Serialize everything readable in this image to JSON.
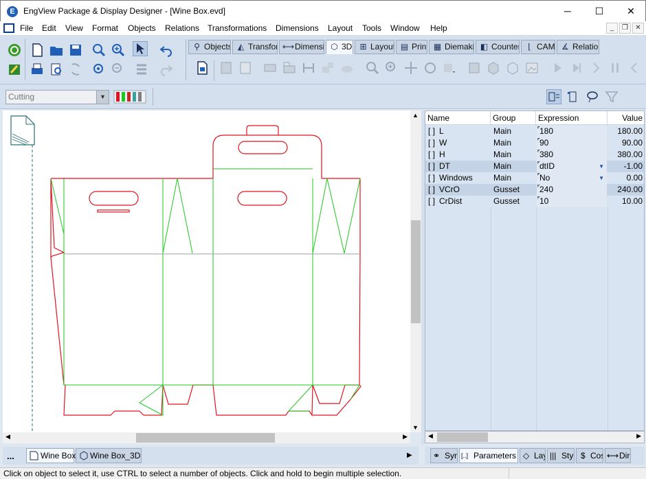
{
  "window": {
    "title": "EngView Package & Display Designer - [Wine Box.evd]",
    "controls": {
      "minimize": "─",
      "maximize": "☐",
      "close": "✕"
    }
  },
  "menu": {
    "items": [
      "File",
      "Edit",
      "View",
      "Format",
      "Objects",
      "Relations",
      "Transformations",
      "Dimensions",
      "Layout",
      "Tools",
      "Window",
      "Help"
    ],
    "mdi": {
      "minimize": "_",
      "restore": "❐",
      "close": "✕"
    }
  },
  "toolbar_tabs": [
    {
      "label": "Objects",
      "glyph": "⚲"
    },
    {
      "label": "Transfor",
      "glyph": "◭"
    },
    {
      "label": "Dimensic",
      "glyph": "⟷"
    },
    {
      "label": "3D",
      "glyph": "⬡"
    },
    {
      "label": "Layout",
      "glyph": "⊞"
    },
    {
      "label": "Print",
      "glyph": "▤"
    },
    {
      "label": "Diemakir",
      "glyph": "▦"
    },
    {
      "label": "Counterp",
      "glyph": "◧"
    },
    {
      "label": "CAM",
      "glyph": "⌊"
    },
    {
      "label": "Relations",
      "glyph": "∡"
    }
  ],
  "active_tab": "3D",
  "mode_combo": {
    "value": "Cutting"
  },
  "parameters": {
    "headers": [
      "Name",
      "Group",
      "Expression",
      "Value"
    ],
    "rows": [
      {
        "name": "L",
        "group": "Main",
        "expression": "180",
        "value": "180.00",
        "dropdown": false
      },
      {
        "name": "W",
        "group": "Main",
        "expression": "90",
        "value": "90.00",
        "dropdown": false
      },
      {
        "name": "H",
        "group": "Main",
        "expression": "380",
        "value": "380.00",
        "dropdown": false
      },
      {
        "name": "DT",
        "group": "Main",
        "expression": "dtID",
        "value": "-1.00",
        "dropdown": true
      },
      {
        "name": "Windows",
        "group": "Main",
        "expression": "No",
        "value": "0.00",
        "dropdown": true
      },
      {
        "name": "VCrO",
        "group": "Gusset",
        "expression": "240",
        "value": "240.00",
        "dropdown": false
      },
      {
        "name": "CrDist",
        "group": "Gusset",
        "expression": "10",
        "value": "10.00",
        "dropdown": false
      }
    ],
    "checkbox_glyph": "[ ]"
  },
  "doc_tabs": {
    "more": "...",
    "tabs": [
      "Wine Box",
      "Wine Box_3D"
    ]
  },
  "panel_tabs": [
    {
      "label": "Syr",
      "glyph": "⚭"
    },
    {
      "label": "Parameters",
      "glyph": "[..]"
    },
    {
      "label": "Lay",
      "glyph": "◇"
    },
    {
      "label": "Sty",
      "glyph": "|||"
    },
    {
      "label": "Cos",
      "glyph": "$"
    },
    {
      "label": "Dir",
      "glyph": "⟷"
    }
  ],
  "status": {
    "text": "Click on object to select it, use CTRL to select a number of objects. Click and hold to begin multiple selection."
  },
  "colors": {
    "cut_line": "#e0141e",
    "crease_line": "#1ec81e",
    "accent": "#1f5fb8",
    "toolbar_bg": "#d4e0ee"
  }
}
